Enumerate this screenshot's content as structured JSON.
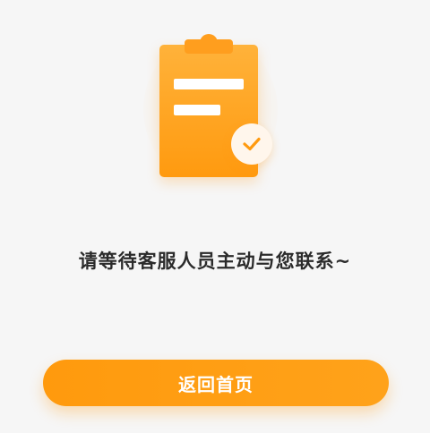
{
  "message": {
    "text": "请等待客服人员主动与您联系~"
  },
  "button": {
    "label": "返回首页"
  },
  "icons": {
    "clipboard": "clipboard-icon",
    "check": "check-icon"
  },
  "colors": {
    "accent": "#ff9a0f",
    "background": "#f6f6f6",
    "text": "#2b2b2b"
  }
}
